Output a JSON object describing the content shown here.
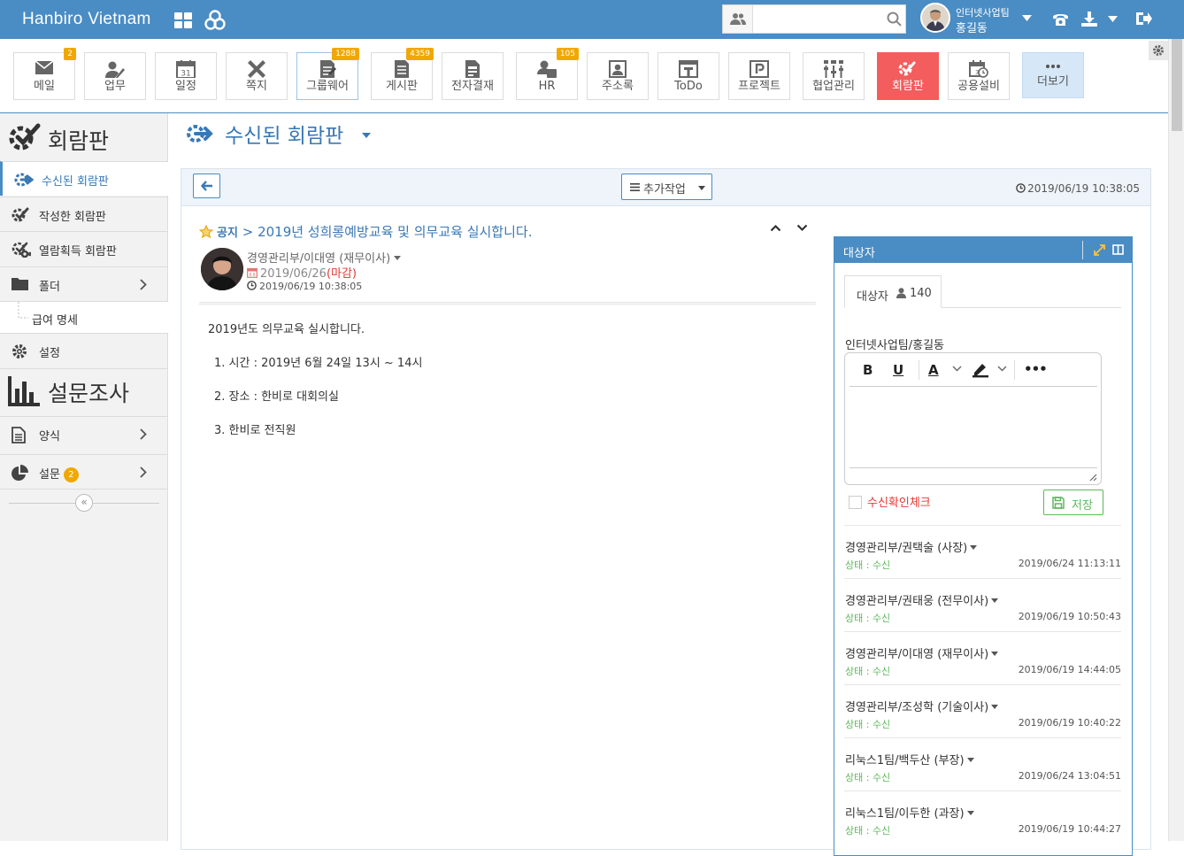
{
  "app": {
    "title": "Hanbiro Vietnam"
  },
  "search": {
    "value": "",
    "placeholder": ""
  },
  "user": {
    "team": "인터넷사업팀",
    "name": "홍길동"
  },
  "colors": {
    "header": "#4a8cc4",
    "active_module": "#f45d5d",
    "badge": "#f0a800",
    "accent_text": "#3a78b5",
    "due": "#e53935",
    "status_ok": "#5cb85c"
  },
  "modules": [
    {
      "label": "메일",
      "icon": "mail-icon",
      "badge": "2"
    },
    {
      "label": "업무",
      "icon": "task-icon",
      "badge": ""
    },
    {
      "label": "일정",
      "icon": "calendar-icon",
      "badge": ""
    },
    {
      "label": "쪽지",
      "icon": "memo-icon",
      "badge": ""
    },
    {
      "label": "그룹웨어",
      "icon": "groupware-icon",
      "badge": "1288"
    },
    {
      "label": "게시판",
      "icon": "board-icon",
      "badge": "4359"
    },
    {
      "label": "전자결재",
      "icon": "approval-icon",
      "badge": ""
    },
    {
      "label": "HR",
      "icon": "hr-icon",
      "badge": "105"
    },
    {
      "label": "주소록",
      "icon": "contacts-icon",
      "badge": ""
    },
    {
      "label": "ToDo",
      "icon": "todo-icon",
      "badge": ""
    },
    {
      "label": "프로젝트",
      "icon": "project-icon",
      "badge": ""
    },
    {
      "label": "협업관리",
      "icon": "collaboration-icon",
      "badge": ""
    },
    {
      "label": "회람판",
      "icon": "circular-icon",
      "badge": ""
    },
    {
      "label": "공용설비",
      "icon": "facility-icon",
      "badge": ""
    },
    {
      "label": "더보기",
      "icon": "more-icon",
      "badge": ""
    }
  ],
  "sidebar": {
    "title": "회람판",
    "items": [
      {
        "label": "수신된 회람판"
      },
      {
        "label": "작성한 회람판"
      },
      {
        "label": "열람획득 회람판"
      },
      {
        "label": "폴더"
      },
      {
        "label": "급여 명세"
      },
      {
        "label": "설정"
      }
    ],
    "survey_title": "설문조사",
    "survey_items": [
      {
        "label": "양식"
      },
      {
        "label": "설문",
        "badge": "2"
      }
    ]
  },
  "page": {
    "title": "수신된 회람판"
  },
  "toolbar": {
    "extra_label": "추가작업",
    "date": "2019/06/19 10:38:05"
  },
  "post": {
    "category": "공지",
    "separator": ">",
    "subject": "2019년 성희롱예방교육 및 의무교육 실시합니다.",
    "author": "경영관리부/이대영 (재무이사)",
    "due_date": "2019/06/26",
    "due_label": "(마감)",
    "created": "2019/06/19 10:38:05",
    "body": [
      "2019년도 의무교육 실시합니다.",
      "1. 시간 : 2019년 6월 24일 13시 ~ 14시",
      "2. 장소 : 한비로 대회의실",
      "3. 한비로 전직원"
    ]
  },
  "recipients_panel": {
    "title": "대상자",
    "tab_label": "대상자",
    "count": "140",
    "me": "인터넷사업팀/홍길동",
    "editor_more": "•••",
    "confirm_label": "수신확인체크",
    "save_label": "저장",
    "list": [
      {
        "name": "경영관리부/권택술 (사장)",
        "status": "상태 : 수신",
        "time": "2019/06/24 11:13:11"
      },
      {
        "name": "경영관리부/권태웅 (전무이사)",
        "status": "상태 : 수신",
        "time": "2019/06/19 10:50:43"
      },
      {
        "name": "경영관리부/이대영 (재무이사)",
        "status": "상태 : 수신",
        "time": "2019/06/19 14:44:05"
      },
      {
        "name": "경영관리부/조성학 (기술이사)",
        "status": "상태 : 수신",
        "time": "2019/06/19 10:40:22"
      },
      {
        "name": "리눅스1팀/백두산 (부장)",
        "status": "상태 : 수신",
        "time": "2019/06/24 13:04:51"
      },
      {
        "name": "리눅스1팀/이두한 (과장)",
        "status": "상태 : 수신",
        "time": "2019/06/19 10:44:27"
      }
    ]
  }
}
